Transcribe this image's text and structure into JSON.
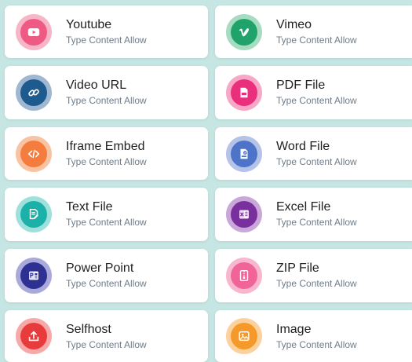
{
  "items": [
    {
      "title": "Youtube",
      "subtitle": "Type Content Allow",
      "icon": "youtube-icon",
      "ring": "#f6b6c8",
      "fill": "#ee5a84"
    },
    {
      "title": "Vimeo",
      "subtitle": "Type Content Allow",
      "icon": "vimeo-icon",
      "ring": "#a6dcc0",
      "fill": "#1fa36a"
    },
    {
      "title": "Video URL",
      "subtitle": "Type Content Allow",
      "icon": "link-icon",
      "ring": "#9fb7d0",
      "fill": "#1d5a8e"
    },
    {
      "title": "PDF File",
      "subtitle": "Type Content Allow",
      "icon": "pdf-file-icon",
      "ring": "#f7a8c6",
      "fill": "#ea2f7d"
    },
    {
      "title": "Iframe Embed",
      "subtitle": "Type Content Allow",
      "icon": "code-icon",
      "ring": "#f9c3a3",
      "fill": "#f47c3c"
    },
    {
      "title": "Word File",
      "subtitle": "Type Content Allow",
      "icon": "word-file-icon",
      "ring": "#b5c3e8",
      "fill": "#4d74c9"
    },
    {
      "title": "Text File",
      "subtitle": "Type Content Allow",
      "icon": "text-file-icon",
      "ring": "#9ee0dc",
      "fill": "#1bb0a8"
    },
    {
      "title": "Excel File",
      "subtitle": "Type Content Allow",
      "icon": "excel-file-icon",
      "ring": "#c9a7d9",
      "fill": "#7a2f9e"
    },
    {
      "title": "Power Point",
      "subtitle": "Type Content Allow",
      "icon": "powerpoint-file-icon",
      "ring": "#a9aadb",
      "fill": "#2e3191"
    },
    {
      "title": "ZIP File",
      "subtitle": "Type Content Allow",
      "icon": "zip-file-icon",
      "ring": "#f8b6cf",
      "fill": "#f06498"
    },
    {
      "title": "Selfhost",
      "subtitle": "Type Content Allow",
      "icon": "upload-icon",
      "ring": "#f7a9a9",
      "fill": "#e83c3c"
    },
    {
      "title": "Image",
      "subtitle": "Type Content Allow",
      "icon": "image-icon",
      "ring": "#fbd19e",
      "fill": "#f59a2a"
    }
  ]
}
